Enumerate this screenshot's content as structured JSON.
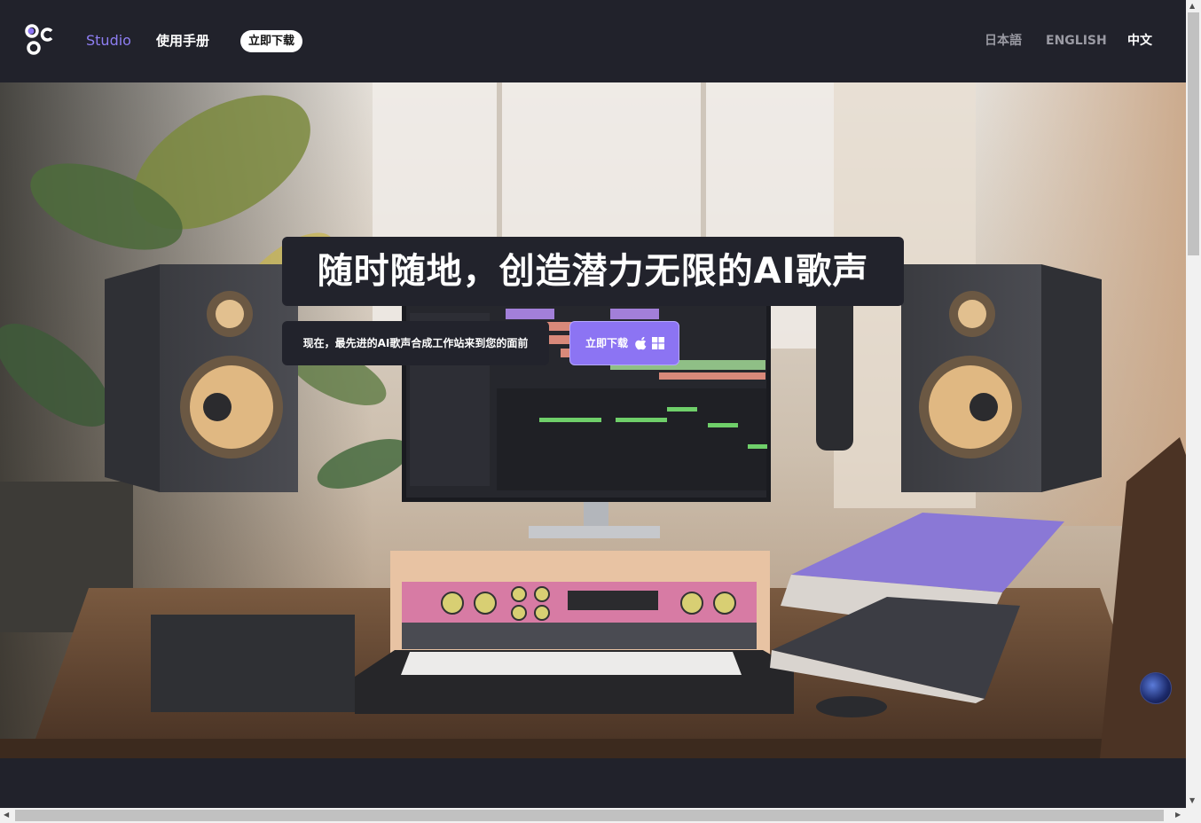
{
  "header": {
    "nav": {
      "studio": "Studio",
      "manual": "使用手册",
      "download": "立即下载"
    },
    "languages": {
      "ja": "日本語",
      "en": "ENGLISH",
      "zh": "中文"
    }
  },
  "hero": {
    "headline": "随时随地，创造潜力无限的AI歌声",
    "subline": "现在，最先进的AI歌声合成工作站来到您的面前",
    "cta_label": "立即下载"
  },
  "colors": {
    "accent": "#8c74f3",
    "background": "#21222b"
  }
}
